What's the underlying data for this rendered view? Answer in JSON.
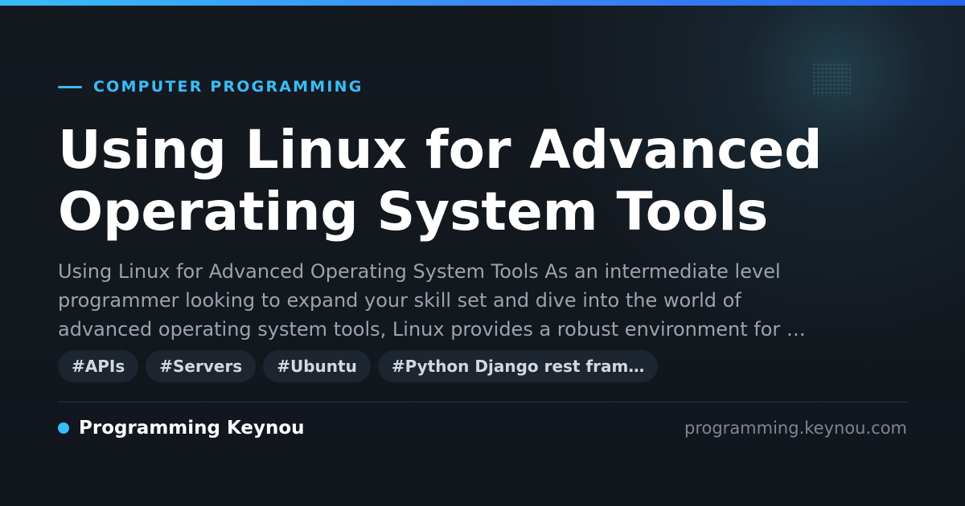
{
  "category": "COMPUTER PROGRAMMING",
  "title_lines": [
    "Using Linux for Advanced",
    "Operating System Tools"
  ],
  "description_lines": [
    "Using Linux for Advanced Operating System Tools As an intermediate level",
    "programmer looking to expand your skill set and dive into the world of",
    "advanced operating system tools, Linux provides a robust environment for …"
  ],
  "tags": [
    "#APIs",
    "#Servers",
    "#Ubuntu",
    "#Python Django rest fram…"
  ],
  "brand": {
    "name": "Programming Keynou",
    "url": "programming.keynou.com"
  },
  "colors": {
    "accent": "#38bdf8",
    "background": "#12161d",
    "tag_background": "#1d2530"
  }
}
